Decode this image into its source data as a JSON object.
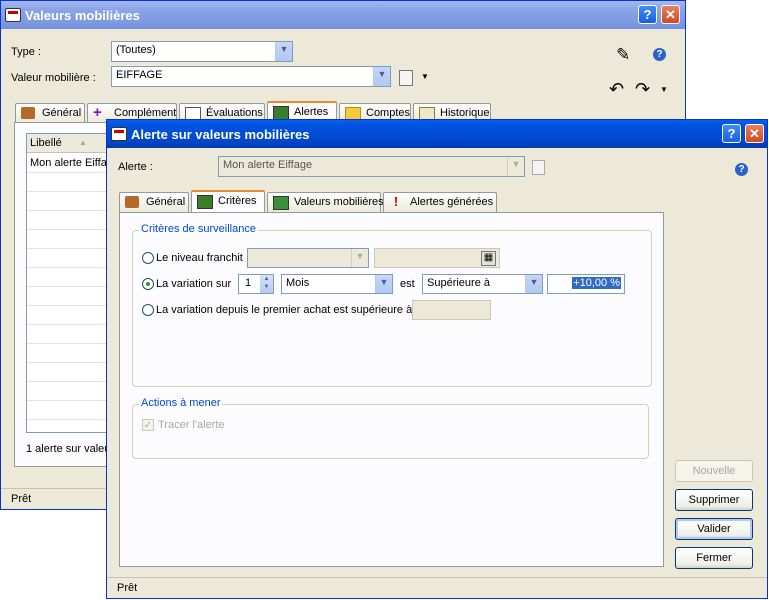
{
  "back_window": {
    "title": "Valeurs mobilières",
    "type_label": "Type :",
    "type_value": "(Toutes)",
    "valeur_label": "Valeur mobilière :",
    "valeur_value": "EIFFAGE",
    "tabs": [
      "Général",
      "Complément",
      "Évaluations",
      "Alertes",
      "Comptes",
      "Historique"
    ],
    "grid_header": "Libellé",
    "grid_row": "Mon alerte Eiffag",
    "count_text": "1 alerte sur valeu",
    "status": "Prêt",
    "help_btn": "?",
    "close_btn": "✕"
  },
  "front_window": {
    "title": "Alerte sur valeurs mobilières",
    "alerte_label": "Alerte :",
    "alerte_value": "Mon alerte Eiffage",
    "tabs": [
      "Général",
      "Critères",
      "Valeurs mobilières",
      "Alertes générées"
    ],
    "criteria_group": "Critères de surveillance",
    "opt_niveau": "Le niveau franchit",
    "opt_variation": "La variation sur",
    "variation_count": "1",
    "variation_period": "Mois",
    "est_label": "est",
    "comparator": "Supérieure à",
    "threshold": "+10,00 %",
    "opt_premier": "La variation depuis le premier achat est supérieure à",
    "actions_group": "Actions à mener",
    "tracer": "Tracer l'alerte",
    "buttons": {
      "nouvelle": "Nouvelle",
      "supprimer": "Supprimer",
      "valider": "Valider",
      "fermer": "Fermer"
    },
    "status": "Prêt",
    "help_btn": "?",
    "close_btn": "✕"
  },
  "icons": {
    "help": "?",
    "dropdown": "▼",
    "spin_up": "▲",
    "spin_down": "▼",
    "calendar": "▦",
    "check": "✓",
    "pencil": "✎",
    "undo": "↶",
    "redo": "↷"
  }
}
